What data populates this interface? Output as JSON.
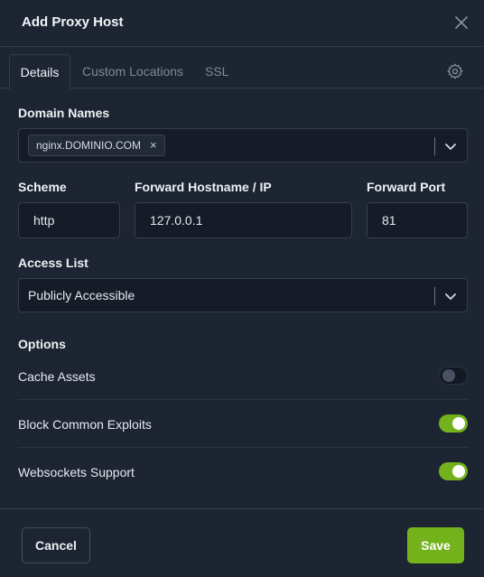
{
  "dialog": {
    "title": "Add Proxy Host"
  },
  "tabs": [
    {
      "label": "Details",
      "active": true
    },
    {
      "label": "Custom Locations",
      "active": false
    },
    {
      "label": "SSL",
      "active": false
    }
  ],
  "domain_names": {
    "label": "Domain Names",
    "tags": [
      "nginx.DOMINIO.COM"
    ],
    "remove_glyph": "×"
  },
  "scheme": {
    "label": "Scheme",
    "value": "http"
  },
  "forward_hostname": {
    "label": "Forward Hostname / IP",
    "value": "127.0.0.1"
  },
  "forward_port": {
    "label": "Forward Port",
    "value": "81"
  },
  "access_list": {
    "label": "Access List",
    "value": "Publicly Accessible"
  },
  "options": {
    "label": "Options",
    "items": [
      {
        "label": "Cache Assets",
        "enabled": false
      },
      {
        "label": "Block Common Exploits",
        "enabled": true
      },
      {
        "label": "Websockets Support",
        "enabled": true
      }
    ]
  },
  "footer": {
    "cancel_label": "Cancel",
    "save_label": "Save"
  },
  "colors": {
    "accent": "#74b21c",
    "background": "#1e2532",
    "input_bg": "#161b27"
  },
  "icons": {
    "close": "close-icon",
    "settings": "gear-icon",
    "dropdown": "chevron-down-icon"
  }
}
